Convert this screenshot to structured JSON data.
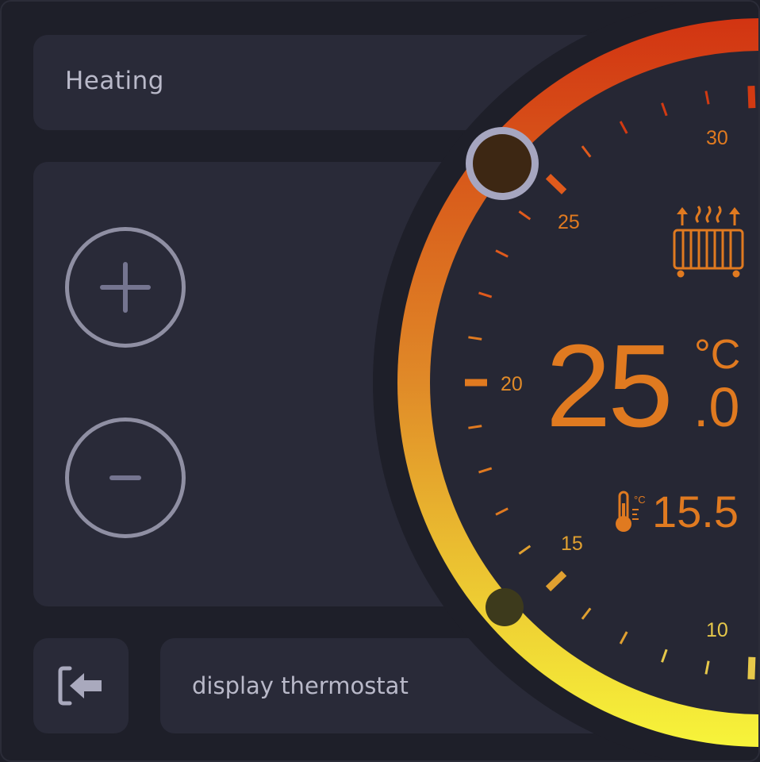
{
  "mode": {
    "label": "Heating"
  },
  "controls": {
    "increase_icon": "plus-icon",
    "decrease_icon": "minus-icon"
  },
  "footer": {
    "back_icon": "exit-arrow-icon",
    "display_label": "display thermostat"
  },
  "thermostat": {
    "setpoint_int": "25",
    "setpoint_dec": ".0",
    "unit": "°C",
    "current_temp": "15.5",
    "current_unit": "°C",
    "scale_labels": [
      "30",
      "25",
      "20",
      "15",
      "10"
    ],
    "heating_icon": "radiator-heating-icon",
    "thermometer_icon": "thermometer-icon",
    "colors": {
      "hot": "#d23a12",
      "warm": "#e07a20",
      "mid": "#e0a030",
      "cool": "#f5f23a",
      "text": "#e07a20",
      "dial_bg": "#262734",
      "dial_ring_bg": "#1e1f29"
    }
  }
}
